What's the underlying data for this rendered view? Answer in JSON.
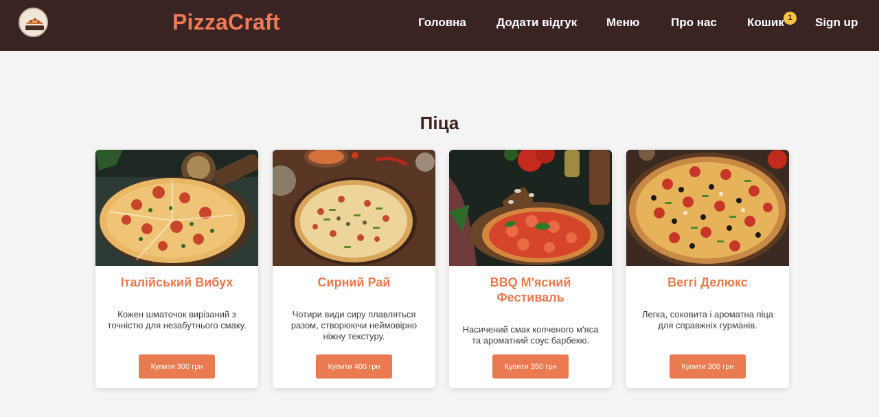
{
  "header": {
    "brand": "PizzaCraft",
    "logo_text": "PIZZACRAFT",
    "nav": [
      {
        "label": "Головна"
      },
      {
        "label": "Додати відгук"
      },
      {
        "label": "Меню"
      },
      {
        "label": "Про нас"
      },
      {
        "label": "Кошик"
      },
      {
        "label": "Sign up"
      }
    ],
    "cart_count": "1"
  },
  "main": {
    "section_title": "Піца",
    "products": [
      {
        "title": "Італійський Вибух",
        "description": "Кожен шматочок вирізаний з точністю для незабутнього смаку.",
        "button": "Купити 300 грн"
      },
      {
        "title": "Сирний Рай",
        "description": "Чотири види сиру плавляться разом, створюючи неймовірно ніжну текстуру.",
        "button": "Купити 400 грн"
      },
      {
        "title": "BBQ М'ясний Фестиваль",
        "description": "Насичений смак копченого м'яса та ароматний соус барбекю.",
        "button": "Купити 350 грн"
      },
      {
        "title": "Веггі Делюкс",
        "description": "Легка, соковита і ароматна піца для справжніх гурманів.",
        "button": "Купити 300 грн"
      }
    ]
  },
  "colors": {
    "header_bg": "#3a2423",
    "accent": "#ea7a4f",
    "badge": "#f6c445",
    "page_bg": "#f4f4f4"
  }
}
